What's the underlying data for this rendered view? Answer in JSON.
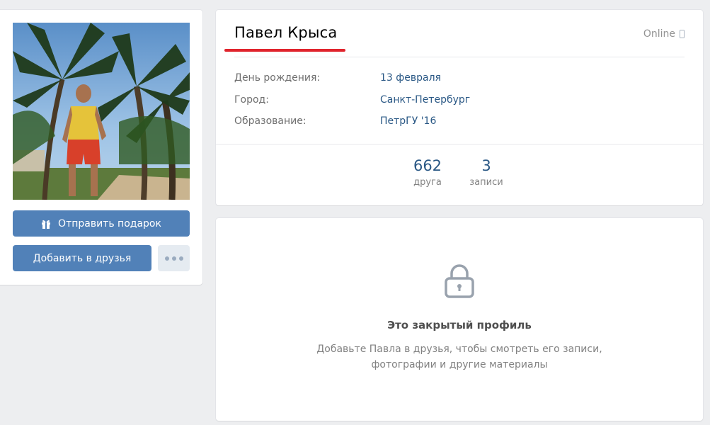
{
  "profile": {
    "name": "Павел Крыса",
    "status": "Online",
    "status_icon": "mobile-phone-icon",
    "info": [
      {
        "label": "День рождения:",
        "value": "13 февраля"
      },
      {
        "label": "Город:",
        "value": "Санкт-Петербург"
      },
      {
        "label": "Образование:",
        "value": "ПетрГУ '16"
      }
    ],
    "counters": [
      {
        "value": "662",
        "label": "друга"
      },
      {
        "value": "3",
        "label": "записи"
      }
    ]
  },
  "actions": {
    "gift_label": "Отправить подарок",
    "gift_icon": "gift-icon",
    "add_friend_label": "Добавить в друзья",
    "more_icon": "more-dots-icon"
  },
  "closed_profile": {
    "icon": "lock-icon",
    "title": "Это закрытый профиль",
    "description_line1": "Добавьте Павла в друзья, чтобы смотреть его записи,",
    "description_line2": "фотографии и другие материалы"
  },
  "colors": {
    "page_background": "#edeef0",
    "button_primary": "#5181b8",
    "link": "#2a5885",
    "annotation_underline": "#e0242d"
  }
}
